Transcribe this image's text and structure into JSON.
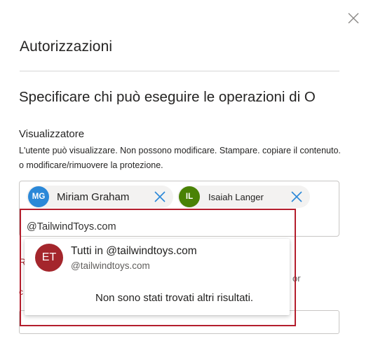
{
  "panel": {
    "title": "Autorizzazioni",
    "heading": "Specificare chi può eseguire le operazioni di O"
  },
  "viewer": {
    "label": "Visualizzatore",
    "description_line1": "L'utente può visualizzare. Non possono modificare. Stampare. copiare il contenuto.",
    "description_line2": "o modificare/rimuovere la protezione."
  },
  "people": [
    {
      "initials": "MG",
      "name": "Miriam Graham",
      "color": "#2b88d8"
    },
    {
      "initials": "IL",
      "name": "Isaiah Langer",
      "color": "#498205"
    }
  ],
  "search": {
    "value": "@TailwindToys.com"
  },
  "suggestions": {
    "item": {
      "initials": "ET",
      "title": "Tutti in @tailwindtoys.com",
      "subtitle": "@tailwindtoys.com"
    },
    "no_results": "Non sono stati trovati altri risultati."
  },
  "partially_hidden": {
    "fragment_1": "R",
    "fragment_2": "or"
  },
  "colors": {
    "highlight": "#b41e2d",
    "avatar_et": "#a4262c"
  }
}
